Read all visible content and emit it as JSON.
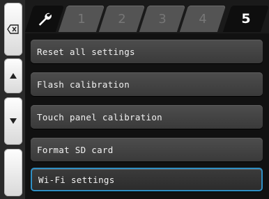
{
  "sidebar": {
    "buttons": [
      {
        "icon": "backspace-icon"
      },
      {
        "icon": "arrow-up-icon"
      },
      {
        "icon": "arrow-down-icon"
      },
      {
        "icon": "blank"
      }
    ]
  },
  "tabs": [
    {
      "label": "",
      "icon": "wrench-icon"
    },
    {
      "label": "1"
    },
    {
      "label": "2"
    },
    {
      "label": "3"
    },
    {
      "label": "4"
    },
    {
      "label": "5",
      "active": true
    }
  ],
  "menu": {
    "items": [
      {
        "label": "Reset all settings"
      },
      {
        "label": "Flash calibration"
      },
      {
        "label": "Touch panel calibration"
      },
      {
        "label": "Format SD card"
      },
      {
        "label": "Wi-Fi settings",
        "selected": true
      }
    ]
  },
  "colors": {
    "selection_border": "#2f8fc4",
    "item_bg": "#444444",
    "tab_inactive": "#545454"
  }
}
